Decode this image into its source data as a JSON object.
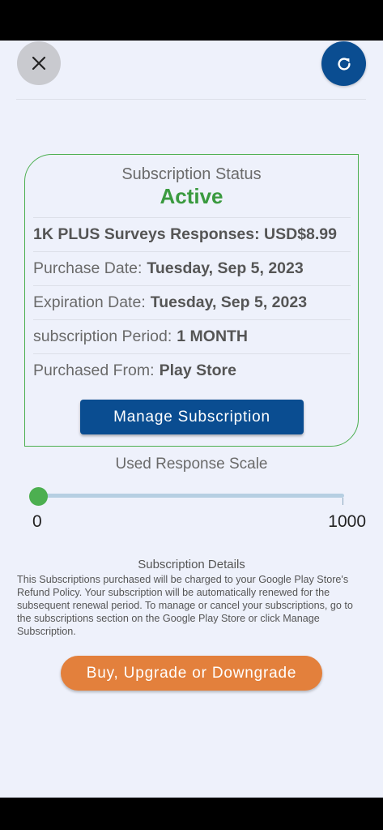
{
  "header": {
    "close_icon": "close-icon",
    "refresh_icon": "refresh-icon"
  },
  "status_card": {
    "title": "Subscription Status",
    "status": "Active",
    "status_color": "#3a9a3f",
    "product": "1K PLUS Surveys Responses: USD$8.99",
    "rows": [
      {
        "label": "Purchase Date:",
        "value": "Tuesday, Sep 5, 2023"
      },
      {
        "label": "Expiration Date:",
        "value": "Tuesday, Sep 5, 2023"
      },
      {
        "label": "subscription Period:",
        "value": "1 MONTH"
      },
      {
        "label": "Purchased From:",
        "value": "Play Store"
      }
    ],
    "manage_label": "Manage Subscription"
  },
  "scale": {
    "title": "Used Response Scale",
    "min": "0",
    "max": "1000",
    "used_value": 0
  },
  "details": {
    "title": "Subscription Details",
    "body": "This Subscriptions purchased will be charged to your Google Play Store's Refund Policy. Your subscription will be automatically renewed for the subsequent renewal period.  To manage or cancel your subscriptions, go to the subscriptions section on the Google Play Store or click Manage Subscription."
  },
  "actions": {
    "buy_label": "Buy, Upgrade or Downgrade"
  },
  "colors": {
    "primary": "#0a4d91",
    "accent_green": "#4caf50",
    "orange": "#e3803c",
    "background": "#eef1fb"
  }
}
